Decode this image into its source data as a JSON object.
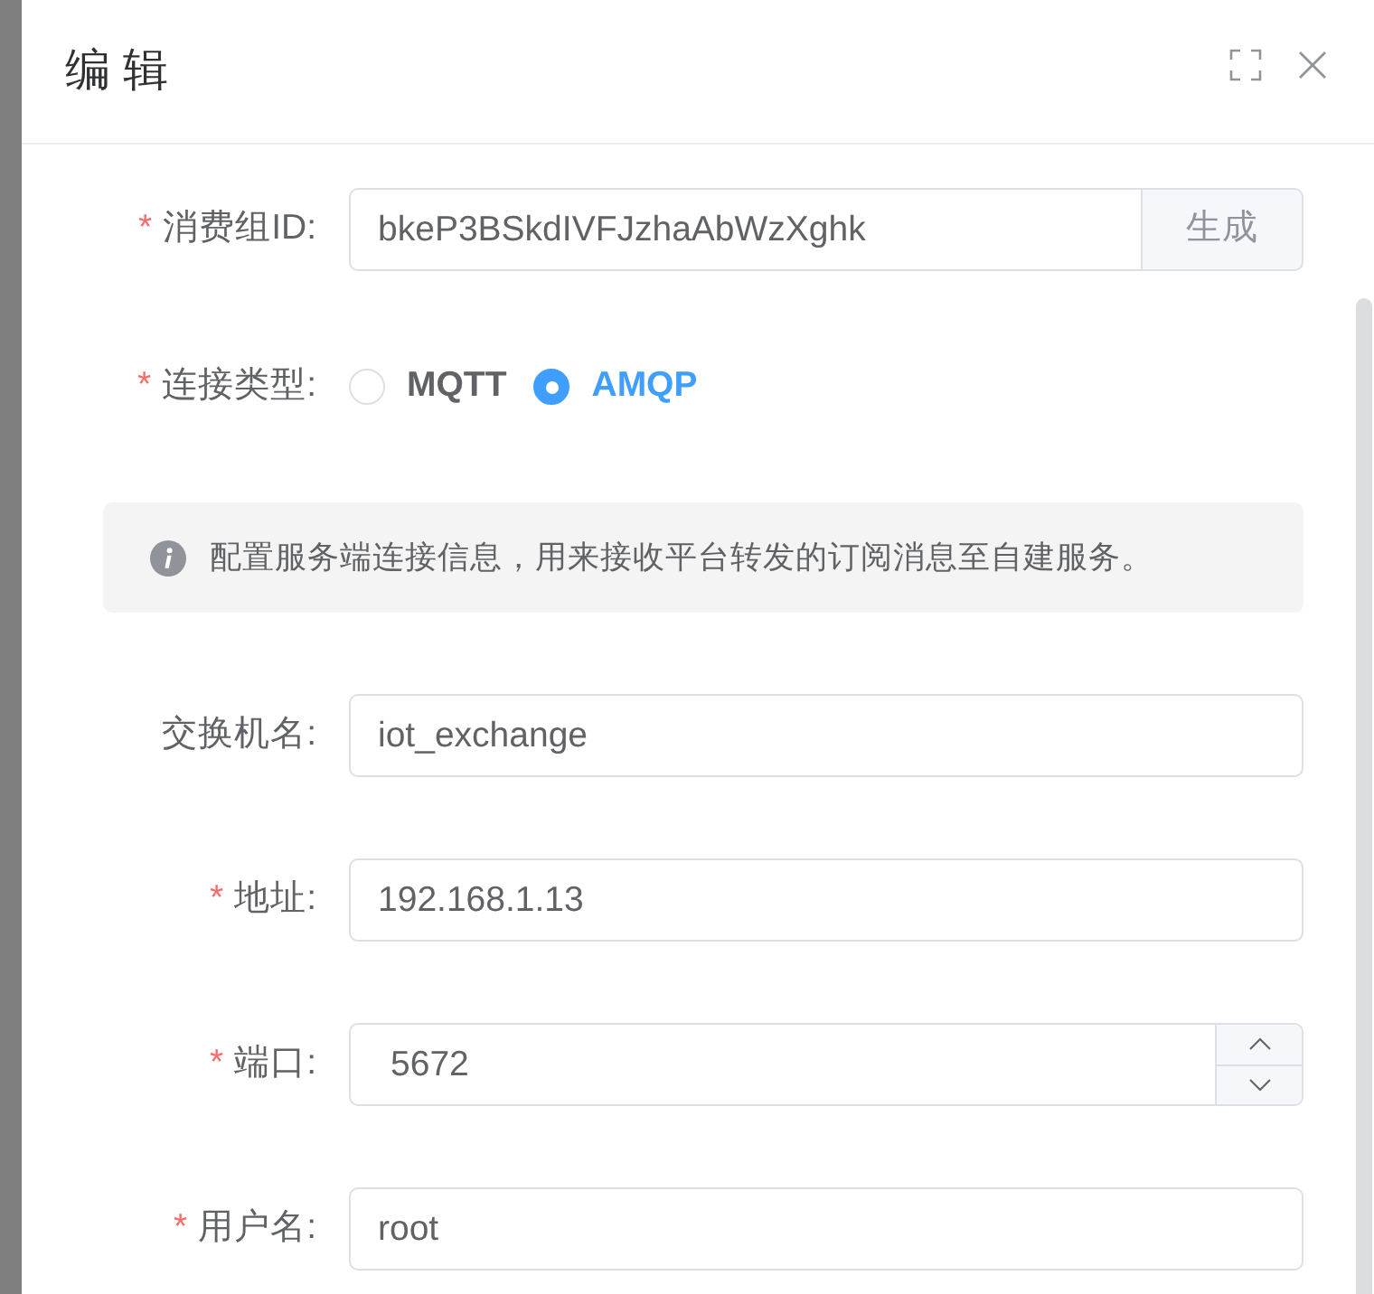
{
  "dialog": {
    "title": "编 辑"
  },
  "form": {
    "fields": [
      {
        "kind": "input_append",
        "required_mark": "*",
        "label": "消费组ID:",
        "value": "bkeP3BSkdIVFJzhaAbWzXghk",
        "append": "生成"
      },
      {
        "kind": "radio",
        "required_mark": "*",
        "label": "连接类型:",
        "options": [
          {
            "label": "MQTT",
            "selected": false
          },
          {
            "label": "AMQP",
            "selected": true
          }
        ]
      },
      {
        "kind": "alert",
        "text": "配置服务端连接信息，用来接收平台转发的订阅消息至自建服务。"
      },
      {
        "kind": "input",
        "label": "交换机名:",
        "value": "iot_exchange"
      },
      {
        "kind": "input",
        "required_mark": "*",
        "label": "地址:",
        "value": "192.168.1.13"
      },
      {
        "kind": "number",
        "required_mark": "*",
        "label": "端口:",
        "value": "5672"
      },
      {
        "kind": "input",
        "required_mark": "*",
        "label": "用户名:",
        "value": "root"
      }
    ]
  }
}
